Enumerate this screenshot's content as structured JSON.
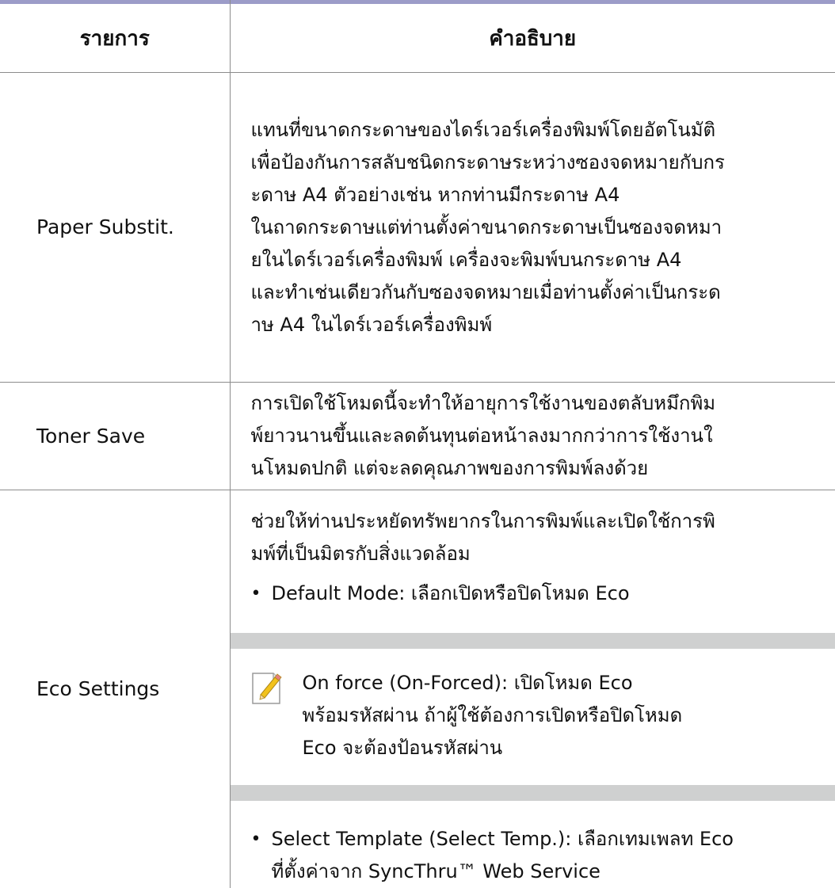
{
  "table": {
    "header": {
      "item": "รายการ",
      "description": "คำอธิบาย"
    },
    "rows": [
      {
        "item": "Paper Substit.",
        "description_lines": [
          "แทนที่ขนาดกระดาษของไดร์เวอร์เครื่องพิมพ์โดยอัตโนมัติ",
          "เพื่อป้องกันการสลับชนิดกระดาษระหว่างซองจดหมายกับกร",
          "ะดาษ A4 ตัวอย่างเช่น หากท่านมีกระดาษ A4",
          "ในถาดกระดาษแต่ท่านตั้งค่าขนาดกระดาษเป็นซองจดหมา",
          "ยในไดร์เวอร์เครื่องพิมพ์ เครื่องจะพิมพ์บนกระดาษ A4",
          "และทำเช่นเดียวกันกับซองจดหมายเมื่อท่านตั้งค่าเป็นกระด",
          "าษ A4 ในไดร์เวอร์เครื่องพิมพ์"
        ]
      },
      {
        "item": "Toner Save",
        "description_lines": [
          "การเปิดใช้โหมดนี้จะทำให้อายุการใช้งานของตลับหมึกพิม",
          "พ์ยาวนานขึ้นและลดต้นทุนต่อหน้าลงมากกว่าการใช้งานใ",
          "นโหมดปกติ แต่จะลดคุณภาพของการพิมพ์ลงด้วย"
        ]
      },
      {
        "item": "Eco Settings",
        "intro_lines": [
          "ช่วยให้ท่านประหยัดทรัพยากรในการพิมพ์และเปิดใช้การพิ",
          "มพ์ที่เป็นมิตรกับสิ่งแวดล้อม"
        ],
        "bullet_1": {
          "bullet_char": "•",
          "term": "Default Mode:",
          "text": " เลือกเปิดหรือปิดโหมด Eco"
        },
        "note": {
          "icon": "note-pencil-icon",
          "term": "On force",
          "paren_open": " (",
          "term_alt": "On-Forced",
          "paren_close": "): เปิดโหมด Eco",
          "lines": [
            "พร้อมรหัสผ่าน ถ้าผู้ใช้ต้องการเปิดหรือปิดโหมด",
            "Eco จะต้องป้อนรหัสผ่าน"
          ]
        },
        "bullet_2": {
          "bullet_char": "•",
          "term": "Select Template (Select Temp.):",
          "text": " เลือกเทมเพลท Eco",
          "line_2": "ที่ตั้งค่าจาก SyncThru™ Web Service"
        }
      }
    ]
  },
  "colors": {
    "top_rule": "#9c9cc8",
    "grid": "#8c8c8c",
    "note_band": "#cfd0d0",
    "note_icon_pencil": "#f2c21b"
  }
}
